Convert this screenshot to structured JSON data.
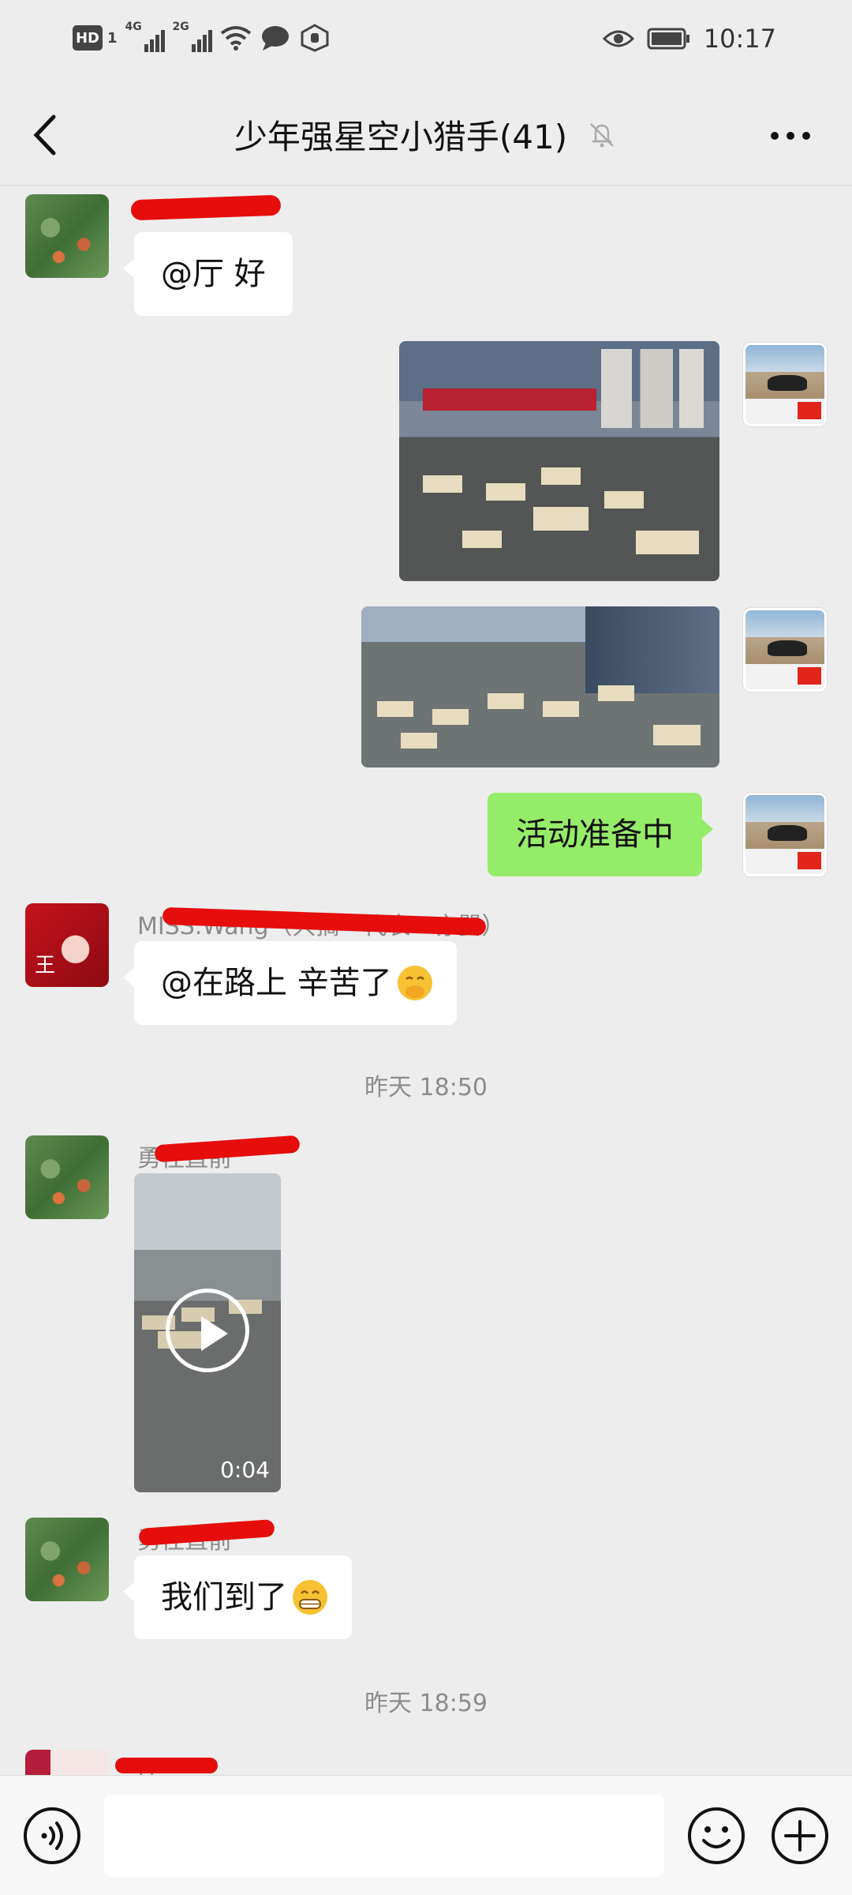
{
  "status_bar": {
    "hd": "HD",
    "sim": "1",
    "net1": "4G",
    "net2": "2G",
    "time": "10:17"
  },
  "header": {
    "title": "少年强星空小猎手(41)"
  },
  "messages": {
    "m1_text": "@厅  好",
    "m4_text": "活动准备中",
    "m5_name": "MISS.Wang（只搞一代表一亦嬰）",
    "m5_text": "@在路上  辛苦了",
    "m6_name": "勇往直前",
    "m6_duration": "0:04",
    "m7_name": "勇往直前",
    "m7_text": "我们到了",
    "m8_name": "厅"
  },
  "timestamps": {
    "t1": "昨天 18:50",
    "t2": "昨天 18:59"
  },
  "input": {
    "placeholder": ""
  },
  "colors": {
    "chat_bg": "#ededed",
    "bubble_left": "#ffffff",
    "bubble_right": "#95ec69",
    "redaction": "#e60d0d"
  },
  "icons": {
    "back": "chevron-left-icon",
    "mute": "bell-off-icon",
    "more": "more-horizontal-icon",
    "voice": "voice-icon",
    "emoji": "emoji-icon",
    "plus": "plus-icon",
    "play": "play-icon"
  }
}
